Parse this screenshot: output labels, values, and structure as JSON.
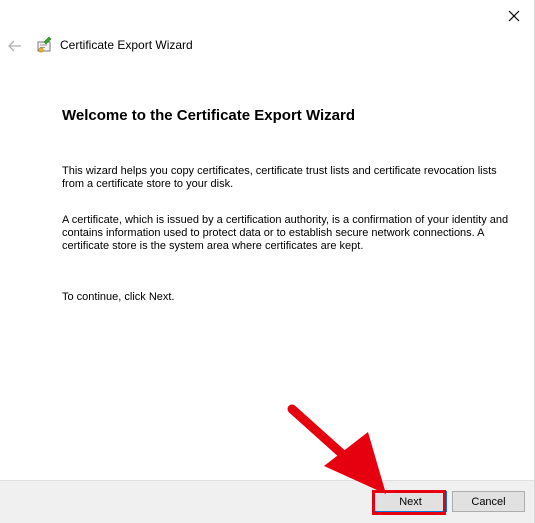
{
  "window": {
    "title": "Certificate Export Wizard"
  },
  "content": {
    "heading": "Welcome to the Certificate Export Wizard",
    "paragraph_1": "This wizard helps you copy certificates, certificate trust lists and certificate revocation lists from a certificate store to your disk.",
    "paragraph_2": "A certificate, which is issued by a certification authority, is a confirmation of your identity and contains information used to protect data or to establish secure network connections. A certificate store is the system area where certificates are kept.",
    "paragraph_3": "To continue, click Next."
  },
  "footer": {
    "next_label": "Next",
    "cancel_label": "Cancel"
  },
  "icons": {
    "close": "close-icon",
    "back": "back-arrow-icon",
    "wizard": "certificate-icon"
  },
  "colors": {
    "annotation_red": "#e6000f",
    "focus_blue": "#0078d7",
    "footer_bg": "#f0f0f0"
  }
}
